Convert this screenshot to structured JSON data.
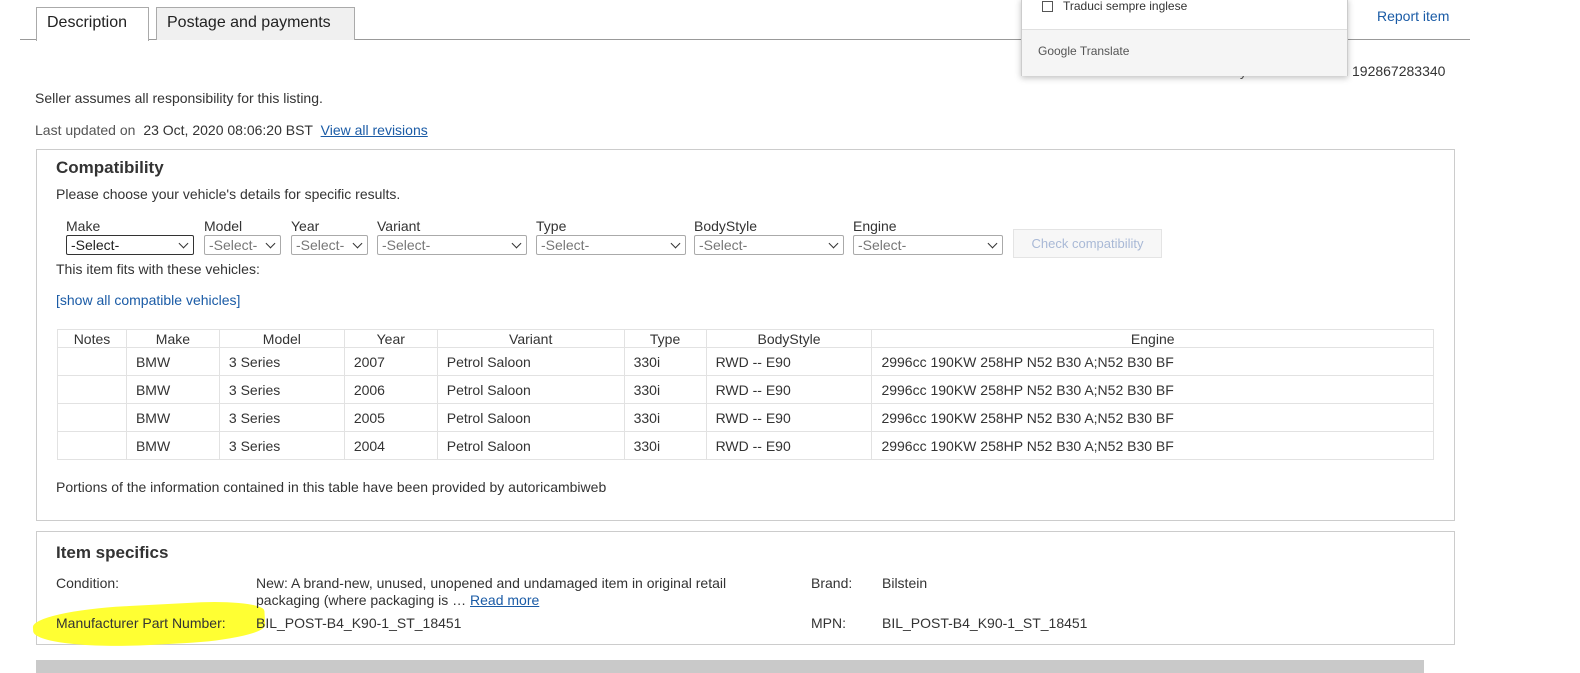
{
  "tabs": [
    "Description",
    "Postage and payments"
  ],
  "report_item": "Report item",
  "item_number": {
    "label": "eBay item number:",
    "value": "192867283340"
  },
  "translate_popup": {
    "checkbox_label": "Traduci sempre inglese",
    "brand": "Google Translate"
  },
  "seller_note": "Seller assumes all responsibility for this listing.",
  "last_updated": {
    "label": "Last updated on",
    "date": "23 Oct, 2020 08:06:20 BST",
    "revisions_link": "View all revisions"
  },
  "compatibility": {
    "title": "Compatibility",
    "hint": "Please choose your vehicle's details for specific results.",
    "selectors": [
      {
        "label": "Make",
        "value": "-Select-"
      },
      {
        "label": "Model",
        "value": "-Select-"
      },
      {
        "label": "Year",
        "value": "-Select-"
      },
      {
        "label": "Variant",
        "value": "-Select-"
      },
      {
        "label": "Type",
        "value": "-Select-"
      },
      {
        "label": "BodyStyle",
        "value": "-Select-"
      },
      {
        "label": "Engine",
        "value": "-Select-"
      }
    ],
    "check_button": "Check compatibility",
    "fits_text": "This item fits with these vehicles:",
    "show_all_link": "[show all compatible vehicles]",
    "columns": [
      "Notes",
      "Make",
      "Model",
      "Year",
      "Variant",
      "Type",
      "BodyStyle",
      "Engine"
    ],
    "rows": [
      [
        "",
        "BMW",
        "3 Series",
        "2007",
        "Petrol Saloon",
        "330i",
        "RWD -- E90",
        "2996cc 190KW 258HP N52 B30 A;N52 B30 BF"
      ],
      [
        "",
        "BMW",
        "3 Series",
        "2006",
        "Petrol Saloon",
        "330i",
        "RWD -- E90",
        "2996cc 190KW 258HP N52 B30 A;N52 B30 BF"
      ],
      [
        "",
        "BMW",
        "3 Series",
        "2005",
        "Petrol Saloon",
        "330i",
        "RWD -- E90",
        "2996cc 190KW 258HP N52 B30 A;N52 B30 BF"
      ],
      [
        "",
        "BMW",
        "3 Series",
        "2004",
        "Petrol Saloon",
        "330i",
        "RWD -- E90",
        "2996cc 190KW 258HP N52 B30 A;N52 B30 BF"
      ]
    ],
    "footnote": "Portions of the information contained in this table have been provided by autoricambiweb"
  },
  "item_specifics": {
    "title": "Item specifics",
    "condition_label": "Condition:",
    "condition_value": "New: A brand-new, unused, unopened and undamaged item in original retail packaging (where packaging is …",
    "read_more": "Read more",
    "brand_label": "Brand:",
    "brand_value": "Bilstein",
    "mpn_full_label": "Manufacturer Part Number:",
    "mpn_full_value": "BIL_POST-B4_K90-1_ST_18451",
    "mpn_label": "MPN:",
    "mpn_value": "BIL_POST-B4_K90-1_ST_18451"
  },
  "colors": {
    "link": "#1a5ba6",
    "highlight": "#ffff33"
  }
}
